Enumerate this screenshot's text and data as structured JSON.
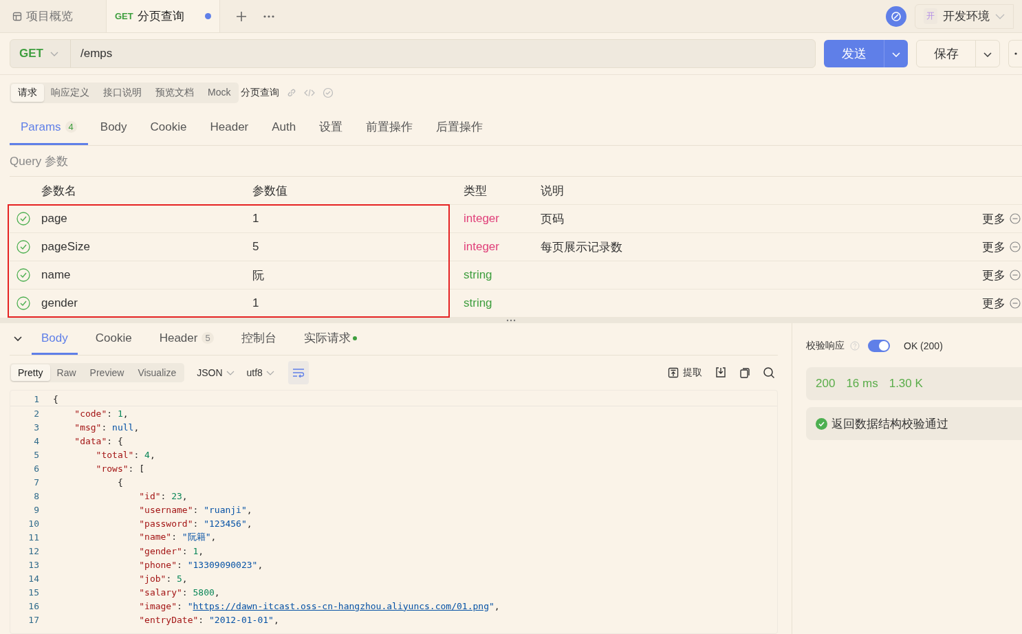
{
  "tabs": [
    {
      "kind": "overview",
      "label": "项目概览",
      "selected": false,
      "unsaved": false
    },
    {
      "kind": "request",
      "method": "GET",
      "label": "分页查询",
      "selected": true,
      "unsaved": true
    }
  ],
  "environment": {
    "badge": "开",
    "label": "开发环境"
  },
  "request": {
    "method": "GET",
    "url": "/emps",
    "send": "发送",
    "save": "保存"
  },
  "doc_tabs": [
    {
      "label": "请求",
      "selected": true
    },
    {
      "label": "响应定义",
      "selected": false
    },
    {
      "label": "接口说明",
      "selected": false
    },
    {
      "label": "预览文档",
      "selected": false
    },
    {
      "label": "Mock",
      "selected": false
    }
  ],
  "api_name": "分页查询",
  "param_tabs": [
    {
      "label": "Params",
      "count": "4",
      "selected": true
    },
    {
      "label": "Body",
      "selected": false
    },
    {
      "label": "Cookie",
      "selected": false
    },
    {
      "label": "Header",
      "selected": false
    },
    {
      "label": "Auth",
      "selected": false
    },
    {
      "label": "设置",
      "selected": false
    },
    {
      "label": "前置操作",
      "selected": false
    },
    {
      "label": "后置操作",
      "selected": false
    }
  ],
  "query_title": "Query 参数",
  "params": {
    "columns": [
      "参数名",
      "参数值",
      "类型",
      "说明"
    ],
    "highlighted": true,
    "rows": [
      {
        "enabled": true,
        "name": "page",
        "value": "1",
        "type": "integer",
        "color": "#e0407a",
        "description": "页码",
        "more": "更多"
      },
      {
        "enabled": true,
        "name": "pageSize",
        "value": "5",
        "type": "integer",
        "color": "#e0407a",
        "description": "每页展示记录数",
        "more": "更多"
      },
      {
        "enabled": true,
        "name": "name",
        "value": "阮",
        "type": "string",
        "color": "#3e9e3e",
        "more": "更多"
      },
      {
        "enabled": true,
        "name": "gender",
        "value": "1",
        "type": "string",
        "color": "#3e9e3e",
        "more": "更多"
      }
    ]
  },
  "response": {
    "tabs": [
      {
        "label": "Body",
        "selected": true
      },
      {
        "label": "Cookie",
        "selected": false
      },
      {
        "label": "Header",
        "count": "5",
        "selected": false
      },
      {
        "label": "控制台",
        "selected": false
      },
      {
        "label": "实际请求",
        "dot": true,
        "selected": false
      }
    ],
    "views": [
      {
        "label": "Pretty",
        "selected": true
      },
      {
        "label": "Raw",
        "selected": false
      },
      {
        "label": "Preview",
        "selected": false
      },
      {
        "label": "Visualize",
        "selected": false
      }
    ],
    "format": "JSON",
    "encoding": "utf8",
    "wrap": true,
    "extract": "提取",
    "lines": [
      {
        "number": "1",
        "tokens": [
          {
            "kind": "punct",
            "text": "{"
          }
        ]
      },
      {
        "number": "2",
        "tokens": [
          {
            "kind": "key",
            "text": "    \"code\""
          },
          {
            "kind": "punct",
            "text": ": "
          },
          {
            "kind": "number",
            "text": "1"
          },
          {
            "kind": "punct",
            "text": ","
          }
        ]
      },
      {
        "number": "3",
        "tokens": [
          {
            "kind": "key",
            "text": "    \"msg\""
          },
          {
            "kind": "punct",
            "text": ": "
          },
          {
            "kind": "null",
            "text": "null"
          },
          {
            "kind": "punct",
            "text": ","
          }
        ]
      },
      {
        "number": "4",
        "tokens": [
          {
            "kind": "key",
            "text": "    \"data\""
          },
          {
            "kind": "punct",
            "text": ": {"
          }
        ]
      },
      {
        "number": "5",
        "tokens": [
          {
            "kind": "key",
            "text": "        \"total\""
          },
          {
            "kind": "punct",
            "text": ": "
          },
          {
            "kind": "number",
            "text": "4"
          },
          {
            "kind": "punct",
            "text": ","
          }
        ]
      },
      {
        "number": "6",
        "tokens": [
          {
            "kind": "key",
            "text": "        \"rows\""
          },
          {
            "kind": "punct",
            "text": ": ["
          }
        ]
      },
      {
        "number": "7",
        "tokens": [
          {
            "kind": "punct",
            "text": "            {"
          }
        ]
      },
      {
        "number": "8",
        "tokens": [
          {
            "kind": "key",
            "text": "                \"id\""
          },
          {
            "kind": "punct",
            "text": ": "
          },
          {
            "kind": "number",
            "text": "23"
          },
          {
            "kind": "punct",
            "text": ","
          }
        ]
      },
      {
        "number": "9",
        "tokens": [
          {
            "kind": "key",
            "text": "                \"username\""
          },
          {
            "kind": "punct",
            "text": ": "
          },
          {
            "kind": "string",
            "text": "\"ruanji\""
          },
          {
            "kind": "punct",
            "text": ","
          }
        ]
      },
      {
        "number": "10",
        "tokens": [
          {
            "kind": "key",
            "text": "                \"password\""
          },
          {
            "kind": "punct",
            "text": ": "
          },
          {
            "kind": "string",
            "text": "\"123456\""
          },
          {
            "kind": "punct",
            "text": ","
          }
        ]
      },
      {
        "number": "11",
        "tokens": [
          {
            "kind": "key",
            "text": "                \"name\""
          },
          {
            "kind": "punct",
            "text": ": "
          },
          {
            "kind": "string",
            "text": "\"阮籍\""
          },
          {
            "kind": "punct",
            "text": ","
          }
        ]
      },
      {
        "number": "12",
        "tokens": [
          {
            "kind": "key",
            "text": "                \"gender\""
          },
          {
            "kind": "punct",
            "text": ": "
          },
          {
            "kind": "number",
            "text": "1"
          },
          {
            "kind": "punct",
            "text": ","
          }
        ]
      },
      {
        "number": "13",
        "tokens": [
          {
            "kind": "key",
            "text": "                \"phone\""
          },
          {
            "kind": "punct",
            "text": ": "
          },
          {
            "kind": "string",
            "text": "\"13309090023\""
          },
          {
            "kind": "punct",
            "text": ","
          }
        ]
      },
      {
        "number": "14",
        "tokens": [
          {
            "kind": "key",
            "text": "                \"job\""
          },
          {
            "kind": "punct",
            "text": ": "
          },
          {
            "kind": "number",
            "text": "5"
          },
          {
            "kind": "punct",
            "text": ","
          }
        ]
      },
      {
        "number": "15",
        "tokens": [
          {
            "kind": "key",
            "text": "                \"salary\""
          },
          {
            "kind": "punct",
            "text": ": "
          },
          {
            "kind": "number",
            "text": "5800"
          },
          {
            "kind": "punct",
            "text": ","
          }
        ]
      },
      {
        "number": "16",
        "tokens": [
          {
            "kind": "key",
            "text": "                \"image\""
          },
          {
            "kind": "punct",
            "text": ": "
          },
          {
            "kind": "string",
            "text": "\""
          },
          {
            "kind": "link",
            "text": "https://dawn-itcast.oss-cn-hangzhou.aliyuncs.com/01.png"
          },
          {
            "kind": "string",
            "text": "\""
          },
          {
            "kind": "punct",
            "text": ","
          }
        ]
      },
      {
        "number": "17",
        "tokens": [
          {
            "kind": "key",
            "text": "                \"entryDate\""
          },
          {
            "kind": "punct",
            "text": ": "
          },
          {
            "kind": "string",
            "text": "\"2012-01-01\""
          },
          {
            "kind": "punct",
            "text": ","
          }
        ]
      }
    ]
  },
  "validation": {
    "label": "校验响应",
    "on": true,
    "status": "OK (200)",
    "code": "200",
    "time": "16 ms",
    "size": "1.30 K",
    "result": "返回数据结构校验通过"
  }
}
